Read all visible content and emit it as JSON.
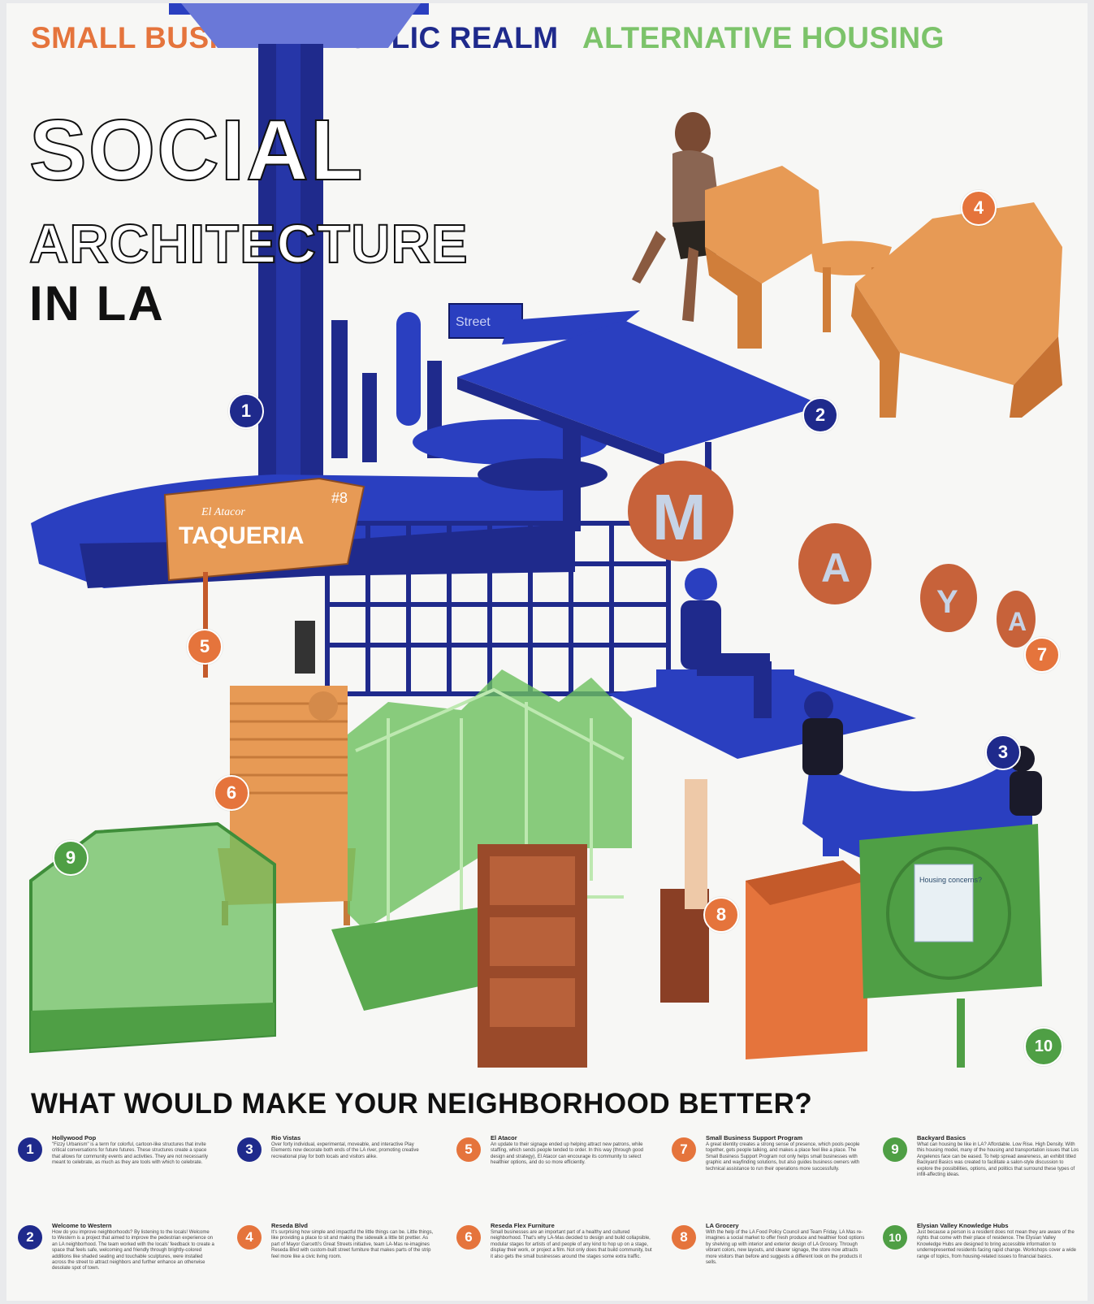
{
  "categories": [
    {
      "label": "SMALL BUSINESS",
      "color": "#e5743c"
    },
    {
      "label": "PUBLIC REALM",
      "color": "#1f2a8c"
    },
    {
      "label": "ALTERNATIVE HOUSING",
      "color": "#7cc36a"
    }
  ],
  "title": {
    "line1": "SOCIAL",
    "line2": "ARCHITECTURE",
    "line3": "IN LA"
  },
  "collage": {
    "street_sign": "Street",
    "taqueria_small": "El Atacor",
    "taqueria_big": "TAQUERIA",
    "taqueria_number": "#8",
    "maya_letters": [
      "M",
      "A",
      "Y",
      "A"
    ],
    "housing_card": "Housing concerns?"
  },
  "markers": [
    "1",
    "2",
    "3",
    "4",
    "5",
    "6",
    "7",
    "8",
    "9",
    "10"
  ],
  "question": "WHAT WOULD MAKE YOUR NEIGHBORHOOD BETTER?",
  "legend": [
    {
      "num": "1",
      "title": "Hollywood Pop",
      "text": "\"Fizzy Urbanism\" is a term for colorful, cartoon-like structures that invite critical conversations for future futures. These structures create a space that allows for community events and activities. They are not necessarily meant to celebrate, as much as they are tools with which to celebrate."
    },
    {
      "num": "2",
      "title": "Welcome to Western",
      "text": "How do you improve neighborhoods? By listening to the locals! Welcome to Western is a project that aimed to improve the pedestrian experience on an LA neighborhood. The team worked with the locals' feedback to create a space that feels safe, welcoming and friendly through brightly-colored additions like shaded seating and touchable sculptures, were installed across the street to attract neighbors and further enhance an otherwise desolate spot of town."
    },
    {
      "num": "3",
      "title": "Rio Vistas",
      "text": "Over forty individual, experimental, moveable, and interactive Play Elements now decorate both ends of the LA river, promoting creative recreational play for both locals and visitors alike."
    },
    {
      "num": "4",
      "title": "Reseda Blvd",
      "text": "It's surprising how simple and impactful the little things can be. Little things, like providing a place to sit and making the sidewalk a little bit prettier. As part of Mayor Garcetti's Great Streets initiative, team LA-Mas re-imagines Reseda Blvd with custom-built street furniture that makes parts of the strip feel more like a civic living room."
    },
    {
      "num": "5",
      "title": "El Atacor",
      "text": "An update to their signage ended up helping attract new patrons, while staffing, which sends people tended to order. In this way (through good design and strategy), El Atacor can encourage its community to select healthier options, and do so more efficiently."
    },
    {
      "num": "6",
      "title": "Reseda Flex Furniture",
      "text": "Small businesses are an important part of a healthy and cultured neighborhood. That's why LA-Mas decided to design and build collapsible, modular stages for artists of and people of any kind to hop up on a stage, display their work, or project a film. Not only does that build community, but it also gets the small businesses around the stages some extra traffic."
    },
    {
      "num": "7",
      "title": "Small Business Support Program",
      "text": "A great identity creates a strong sense of presence, which pools people together, gets people talking, and makes a place feel like a place. The Small Business Support Program not only helps small businesses with graphic and wayfinding solutions, but also guides business owners with technical assistance to run their operations more successfully."
    },
    {
      "num": "8",
      "title": "LA Grocery",
      "text": "With the help of the LA Food Policy Council and Team Friday, LA Mas re-imagines a social market to offer fresh produce and healthier food options by shelving up with interior and exterior design of LA Grocery. Through vibrant colors, new layouts, and clearer signage, the store now attracts more visitors than before and suggests a different look on the products it sells."
    },
    {
      "num": "9",
      "title": "Backyard Basics",
      "text": "What can housing be like in LA? Affordable. Low Rise. High Density. With this housing model, many of the housing and transportation issues that Los Angelenos face can be eased. To help spread awareness, an exhibit titled Backyard Basics was created to facilitate a salon-style discussion to explore the possibilities, options, and politics that surround these types of infill-affecting ideas."
    },
    {
      "num": "10",
      "title": "Elysian Valley Knowledge Hubs",
      "text": "Just because a person is a resident does not mean they are aware of the rights that come with their place of residence. The Elysian Valley Knowledge Hubs are designed to bring accessible information to underrepresented residents facing rapid change. Workshops cover a wide range of topics, from housing-related issues to financial basics."
    }
  ],
  "colors": {
    "blue": "#1f2a8c",
    "royal_blue": "#2a3fc0",
    "orange": "#e5743c",
    "wood": "#e79a55",
    "green": "#4f9f45",
    "light_green": "#7cc36a",
    "brown": "#9a4a2a"
  }
}
